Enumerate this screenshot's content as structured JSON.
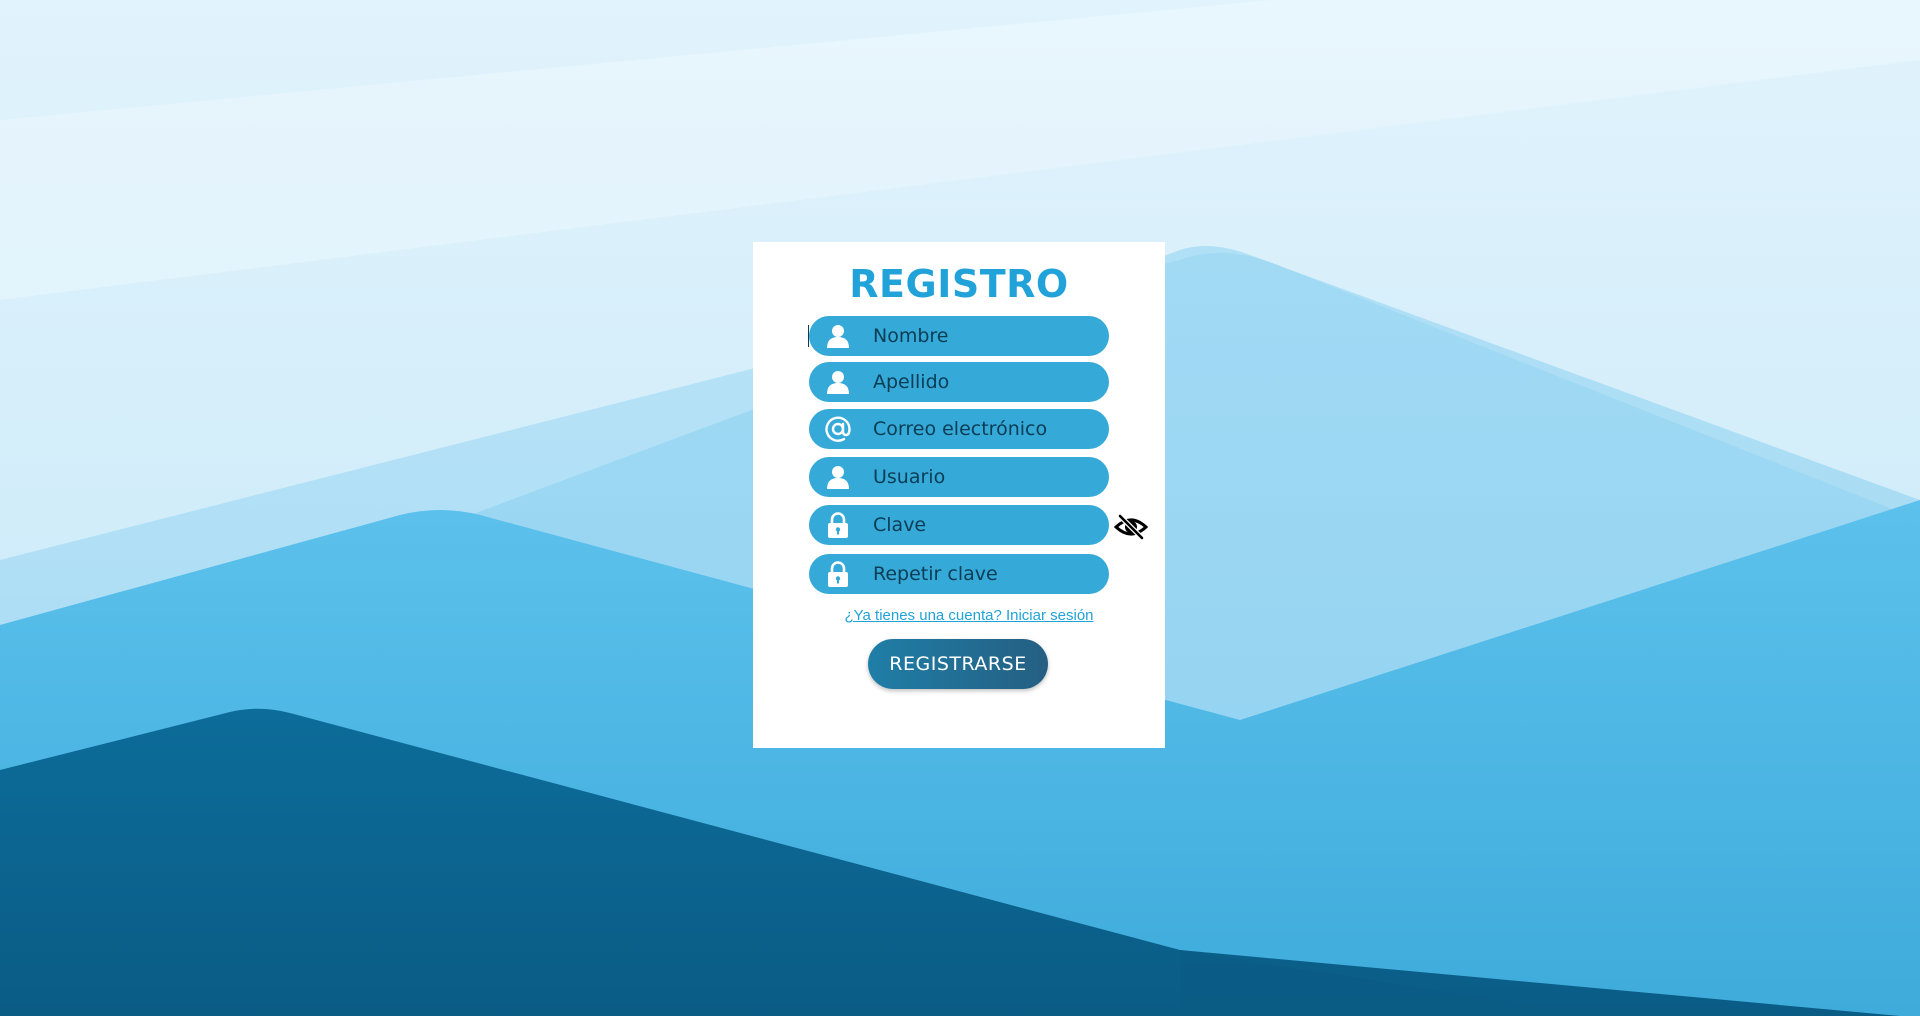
{
  "form": {
    "title": "REGISTRO",
    "fields": [
      {
        "id": "nombre",
        "placeholder": "Nombre",
        "value": "",
        "icon": "user-icon",
        "type": "text"
      },
      {
        "id": "apellido",
        "placeholder": "Apellido",
        "value": "",
        "icon": "user-icon",
        "type": "text"
      },
      {
        "id": "correo",
        "placeholder": "Correo electrónico",
        "value": "",
        "icon": "at-icon",
        "type": "email"
      },
      {
        "id": "usuario",
        "placeholder": "Usuario",
        "value": "",
        "icon": "user-icon",
        "type": "text"
      },
      {
        "id": "clave",
        "placeholder": "Clave",
        "value": "",
        "icon": "lock-icon",
        "type": "password"
      },
      {
        "id": "repetir_clave",
        "placeholder": "Repetir clave",
        "value": "",
        "icon": "lock-icon",
        "type": "password"
      }
    ],
    "password_toggle_icon": "eye-slash-icon",
    "login_link": "¿Ya tienes una cuenta? Iniciar sesión",
    "submit_label": "REGISTRARSE"
  },
  "colors": {
    "accent": "#21a2d8",
    "field_background": "#35a9d8",
    "field_text": "#0b3d55",
    "button_start": "#1f7ea7",
    "button_end": "#255f82",
    "card_background": "#ffffff",
    "background_light": "#d6eef9",
    "background_dark": "#0b6491"
  }
}
